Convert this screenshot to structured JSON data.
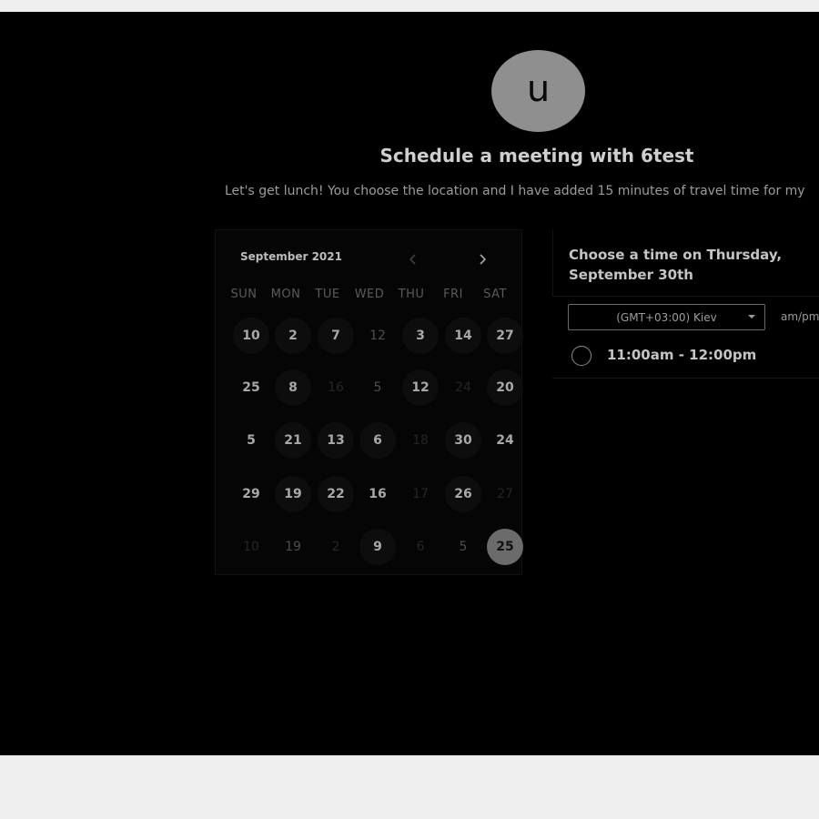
{
  "avatar": {
    "initial": "u"
  },
  "header": {
    "title": "Schedule a meeting with 6test",
    "description": "Let's get lunch! You choose the location and I have added 15 minutes of travel time for my"
  },
  "calendar": {
    "month": "September 2021",
    "weekdays": [
      "SUN",
      "MON",
      "TUE",
      "WED",
      "THU",
      "FRI",
      "SAT"
    ],
    "weeks": [
      [
        {
          "d": "10",
          "s": "avail"
        },
        {
          "d": "2",
          "s": "avail"
        },
        {
          "d": "7",
          "s": "avail"
        },
        {
          "d": "12",
          "s": "muted"
        },
        {
          "d": "3",
          "s": "avail"
        },
        {
          "d": "14",
          "s": "avail"
        },
        {
          "d": "27",
          "s": "avail"
        }
      ],
      [
        {
          "d": "25",
          "s": "plain"
        },
        {
          "d": "8",
          "s": "avail"
        },
        {
          "d": "16",
          "s": "dim"
        },
        {
          "d": "5",
          "s": "muted"
        },
        {
          "d": "12",
          "s": "avail"
        },
        {
          "d": "24",
          "s": "dim"
        },
        {
          "d": "20",
          "s": "avail"
        }
      ],
      [
        {
          "d": "5",
          "s": "plain"
        },
        {
          "d": "21",
          "s": "avail"
        },
        {
          "d": "13",
          "s": "avail"
        },
        {
          "d": "6",
          "s": "avail"
        },
        {
          "d": "18",
          "s": "dim"
        },
        {
          "d": "30",
          "s": "avail"
        },
        {
          "d": "24",
          "s": "plain"
        }
      ],
      [
        {
          "d": "29",
          "s": "plain"
        },
        {
          "d": "19",
          "s": "avail"
        },
        {
          "d": "22",
          "s": "avail"
        },
        {
          "d": "16",
          "s": "plain"
        },
        {
          "d": "17",
          "s": "dim"
        },
        {
          "d": "26",
          "s": "avail"
        },
        {
          "d": "27",
          "s": "dim"
        }
      ],
      [
        {
          "d": "10",
          "s": "dim"
        },
        {
          "d": "19",
          "s": "muted"
        },
        {
          "d": "2",
          "s": "dim"
        },
        {
          "d": "9",
          "s": "avail"
        },
        {
          "d": "6",
          "s": "dim"
        },
        {
          "d": "5",
          "s": "muted"
        },
        {
          "d": "25",
          "s": "selected"
        }
      ]
    ]
  },
  "time_panel": {
    "heading": "Choose a time on Thursday, September 30th",
    "timezone": "(GMT+03:00) Kiev",
    "format": "am/pm",
    "slots": [
      "11:00am - 12:00pm"
    ]
  },
  "colors": {
    "background": "#000000",
    "frame": "#efefef",
    "selected_day": "#6b6b6b"
  }
}
